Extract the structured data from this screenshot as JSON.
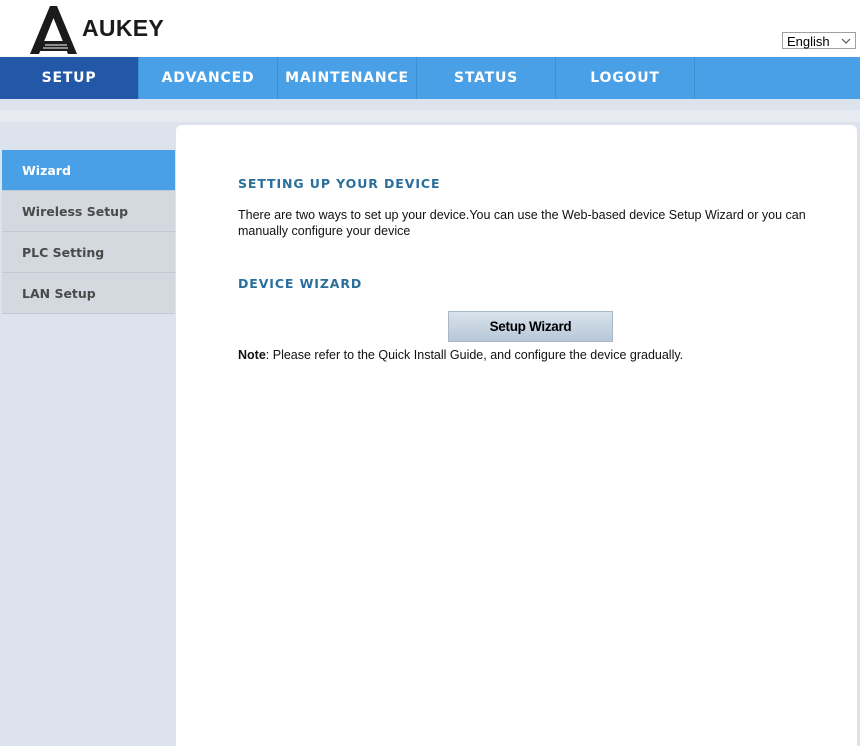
{
  "brand": {
    "name": "AUKEY"
  },
  "language": {
    "selected": "English"
  },
  "nav": {
    "tabs": [
      {
        "label": "SETUP",
        "active": true
      },
      {
        "label": "ADVANCED",
        "active": false
      },
      {
        "label": "MAINTENANCE",
        "active": false
      },
      {
        "label": "STATUS",
        "active": false
      },
      {
        "label": "LOGOUT",
        "active": false
      }
    ]
  },
  "sidebar": {
    "items": [
      {
        "label": "Wizard",
        "active": true
      },
      {
        "label": "Wireless Setup",
        "active": false
      },
      {
        "label": "PLC Setting",
        "active": false
      },
      {
        "label": "LAN Setup",
        "active": false
      }
    ]
  },
  "main": {
    "section1_title": "SETTING UP YOUR DEVICE",
    "intro_text": "There are two ways to set up your device.You can use the Web-based device Setup Wizard or you can manually configure your device",
    "section2_title": "DEVICE WIZARD",
    "wizard_button": "Setup Wizard",
    "note_label": "Note",
    "note_text": ": Please refer to the Quick Install Guide, and configure the device gradually."
  },
  "colors": {
    "nav_bg": "#4aa0e6",
    "nav_active": "#2358a8",
    "section_title": "#2a6f9c",
    "page_bg": "#dde3ec"
  },
  "icons": {
    "logo": "aukey-a-logo-icon",
    "dropdown": "chevron-down-icon"
  }
}
